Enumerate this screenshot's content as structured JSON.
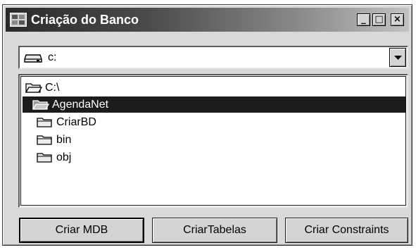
{
  "window": {
    "title": "Criação do Banco",
    "controls": {
      "minimize": "_",
      "maximize": "□",
      "close": "×"
    }
  },
  "drive_select": {
    "value": "c:",
    "icon": "drive-icon"
  },
  "directory_list": {
    "items": [
      {
        "label": "C:\\",
        "icon": "open-folder-icon"
      },
      {
        "label": "AgendaNet",
        "icon": "open-folder-icon"
      },
      {
        "label": "CriarBD",
        "icon": "folder-icon"
      },
      {
        "label": "bin",
        "icon": "folder-icon"
      },
      {
        "label": "obj",
        "icon": "folder-icon"
      }
    ],
    "selected_index": 1
  },
  "buttons": {
    "criar_mdb": "Criar MDB",
    "criar_tabelas": "CriarTabelas",
    "criar_constraints": "Criar Constraints"
  }
}
